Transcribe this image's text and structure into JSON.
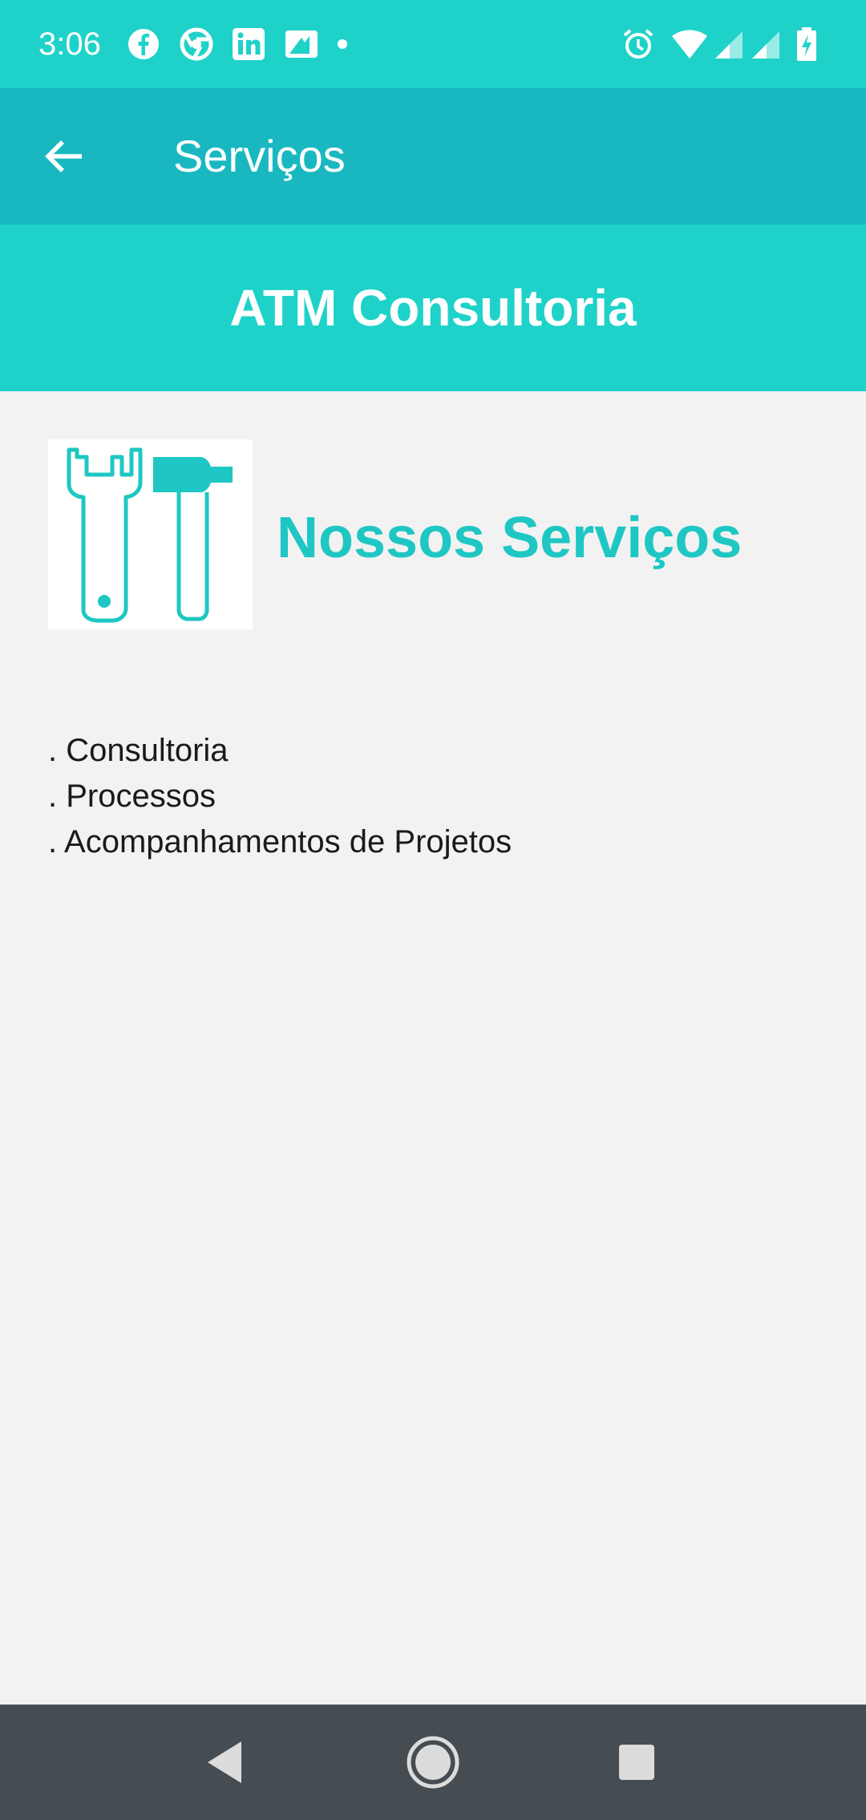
{
  "status_bar": {
    "time": "3:06",
    "notifications": [
      "facebook-icon",
      "chrome-icon",
      "linkedin-icon",
      "image-icon",
      "dot-icon"
    ],
    "system_icons": [
      "alarm-icon",
      "wifi-icon",
      "signal-icon",
      "signal-icon",
      "battery-charging-icon"
    ]
  },
  "toolbar": {
    "title": "Serviços",
    "back_icon": "arrow-back-icon"
  },
  "banner": {
    "title": "ATM Consultoria"
  },
  "main": {
    "image_icon": "wrench-hammer-icon",
    "section_title": "Nossos Serviços",
    "services": [
      ". Consultoria",
      ". Processos",
      ". Acompanhamentos de Projetos"
    ]
  },
  "nav_bar": {
    "buttons": [
      "back-triangle-icon",
      "home-circle-icon",
      "recents-square-icon"
    ]
  },
  "colors": {
    "status_bar": "#1ed2c9",
    "toolbar": "#19b8c1",
    "banner": "#1ed2c9",
    "accent": "#1ec7c3",
    "background": "#f2f2f2",
    "nav_bar": "#454c52"
  }
}
